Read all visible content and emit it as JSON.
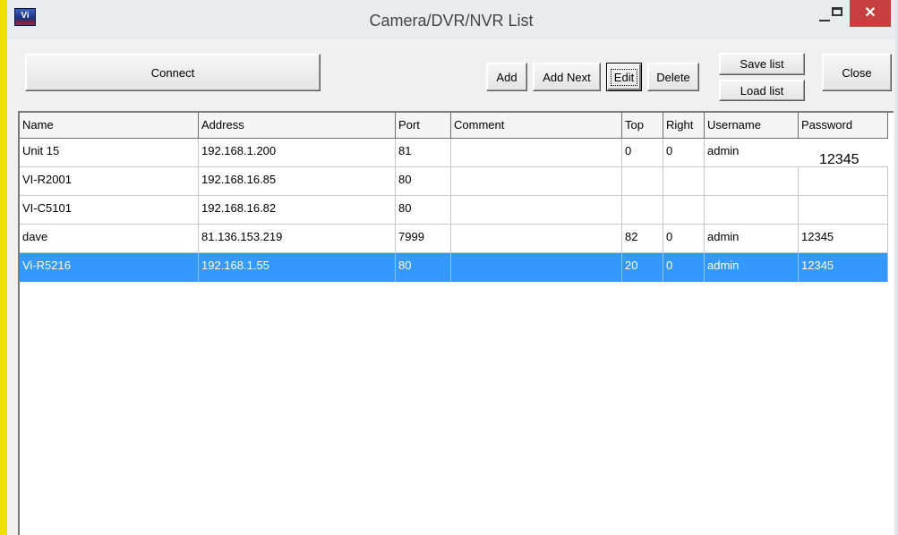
{
  "window": {
    "title": "Camera/DVR/NVR List",
    "icon": "vi-app-icon",
    "close_glyph": "✕"
  },
  "toolbar": {
    "connect": "Connect",
    "add": "Add",
    "add_next": "Add Next",
    "edit": "Edit",
    "delete": "Delete",
    "save_list": "Save list",
    "load_list": "Load list",
    "close": "Close"
  },
  "table": {
    "columns": [
      "Name",
      "Address",
      "Port",
      "Comment",
      "Top",
      "Right",
      "Username",
      "Password"
    ],
    "rows": [
      [
        "Unit 15",
        "192.168.1.200",
        "81",
        "",
        "0",
        "0",
        "admin",
        ""
      ],
      [
        "VI-R2001",
        "192.168.16.85",
        "80",
        "",
        "",
        "",
        "",
        ""
      ],
      [
        "VI-C5101",
        "192.168.16.82",
        "80",
        "",
        "",
        "",
        "",
        ""
      ],
      [
        "dave",
        "81.136.153.219",
        "7999",
        "",
        "82",
        "0",
        "admin",
        "12345"
      ],
      [
        "Vi-R5216",
        "192.168.1.55",
        "80",
        "",
        "20",
        "0",
        "admin",
        "12345"
      ]
    ],
    "selected_row": 4,
    "edit_overlay_value": "12345"
  },
  "colors": {
    "selection": "#3399ff",
    "close_button": "#c74040",
    "left_edge": "#f0e000"
  }
}
